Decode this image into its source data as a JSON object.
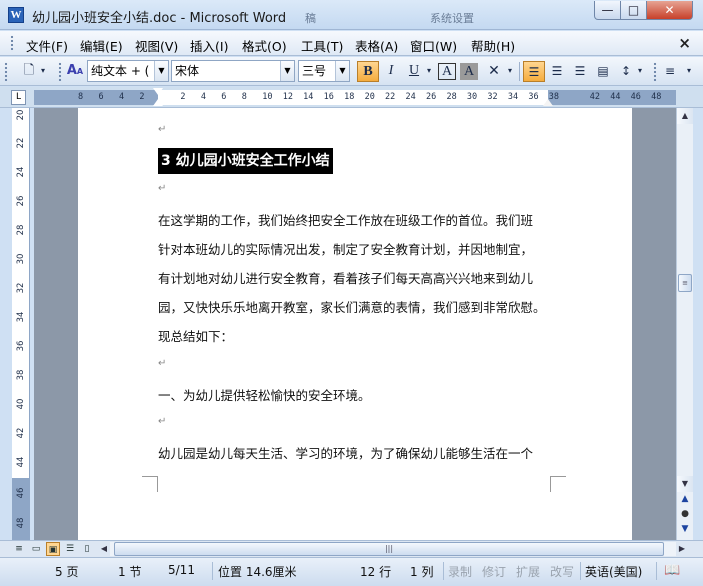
{
  "window": {
    "title": "幼儿园小班安全小结.doc - Microsoft Word",
    "app_icon": "W",
    "minimize": "—",
    "maximize": "□",
    "close": "✕",
    "background_tabs": [
      "稿",
      "系统设置"
    ]
  },
  "menu": {
    "items": [
      "文件(F)",
      "编辑(E)",
      "视图(V)",
      "插入(I)",
      "格式(O)",
      "工具(T)",
      "表格(A)",
      "窗口(W)",
      "帮助(H)"
    ],
    "doc_close": "×"
  },
  "toolbar": {
    "style_value": "纯文本 + (",
    "font_value": "宋体",
    "size_value": "三号",
    "bold_label": "B",
    "italic_label": "I",
    "underline_label": "U",
    "char_border_label": "A",
    "char_shade_label": "A",
    "new_icon": "new-document-icon",
    "align_left_active": true
  },
  "ruler": {
    "corner_label": "L",
    "numbers": "8   6   4   2       2   4   6   8   10  12  14  16  18  20  22  24  26  28  30  32  34  36  38      42  44  46  48",
    "vertical_numbers": [
      "20",
      "22",
      "24",
      "26",
      "28",
      "30",
      "32",
      "34",
      "36",
      "38",
      "40",
      "42",
      "44",
      "46",
      "48"
    ]
  },
  "document": {
    "paragraph_mark": "↵",
    "heading": "3 幼儿园小班安全工作小结",
    "lines": [
      "在这学期的工作，我们始终把安全工作放在班级工作的首位。我们班",
      "针对本班幼儿的实际情况出发，制定了安全教育计划，并因地制宜，",
      "有计划地对幼儿进行安全教育，看着孩子们每天高高兴兴地来到幼儿",
      "园，又快快乐乐地离开教室，家长们满意的表情，我们感到非常欣慰。",
      "现总结如下："
    ],
    "section_heading": "一、为幼儿提供轻松愉快的安全环境。",
    "last_line": "幼儿园是幼儿每天生活、学习的环境，为了确保幼儿能够生活在一个"
  },
  "statusbar": {
    "page": "5 页",
    "section": "1 节",
    "page_of": "5/11",
    "position": "位置 14.6厘米",
    "line": "12 行",
    "column": "1 列",
    "rec": "录制",
    "trk": "修订",
    "ext": "扩展",
    "ovr": "改写",
    "language": "英语(美国)"
  }
}
